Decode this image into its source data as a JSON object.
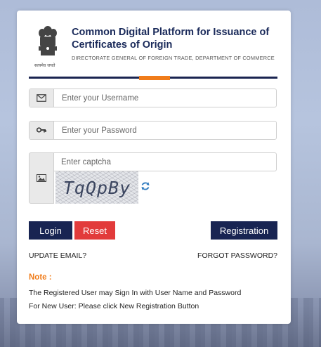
{
  "header": {
    "title_line1": "Common Digital Platform for Issuance of",
    "title_line2": "Certificates of Origin",
    "subtitle": "DIRECTORATE GENERAL OF FOREIGN TRADE, DEPARTMENT OF COMMERCE",
    "emblem_caption": "सत्यमेव जयते"
  },
  "form": {
    "username_placeholder": "Enter your Username",
    "password_placeholder": "Enter your Password",
    "captcha_placeholder": "Enter captcha",
    "captcha_text": "TqQpBy"
  },
  "buttons": {
    "login": "Login",
    "reset": "Reset",
    "registration": "Registration"
  },
  "links": {
    "update_email": "UPDATE EMAIL?",
    "forgot_password": "FORGOT PASSWORD?"
  },
  "note": {
    "title": "Note :",
    "line1": "The Registered User may Sign In with User Name and Password",
    "line2": "For New User: Please click New Registration Button"
  },
  "colors": {
    "navy": "#182452",
    "accent_orange": "#f07c1a",
    "reset_red": "#e23b3b"
  }
}
